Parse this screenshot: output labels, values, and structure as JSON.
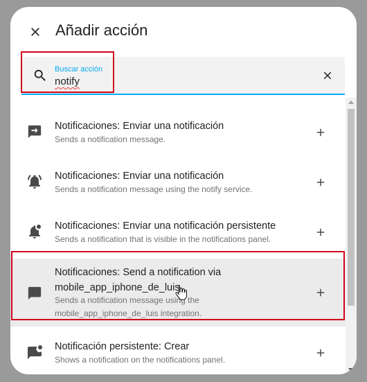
{
  "dialog": {
    "title": "Añadir acción"
  },
  "search": {
    "label": "Buscar acción",
    "value": "notify"
  },
  "items": [
    {
      "title": "Notificaciones: Enviar una notificación",
      "subtitle": "Sends a notification message.",
      "icon": "message-arrow-icon"
    },
    {
      "title": "Notificaciones: Enviar una notificación",
      "subtitle": "Sends a notification message using the notify service.",
      "icon": "bell-ring-icon"
    },
    {
      "title": "Notificaciones: Enviar una notificación persistente",
      "subtitle": "Sends a notification that is visible in the notifications panel.",
      "icon": "bell-badge-icon"
    },
    {
      "title": "Notificaciones: Send a notification via mobile_app_iphone_de_luis",
      "subtitle": "Sends a notification message using the mobile_app_iphone_de_luis integration.",
      "icon": "message-icon"
    },
    {
      "title": "Notificación persistente: Crear",
      "subtitle": "Shows a notification on the notifications panel.",
      "icon": "message-badge-icon"
    }
  ],
  "colors": {
    "accent": "#03a9f4",
    "highlight": "#d0021b",
    "icon": "#4a4a4a"
  }
}
